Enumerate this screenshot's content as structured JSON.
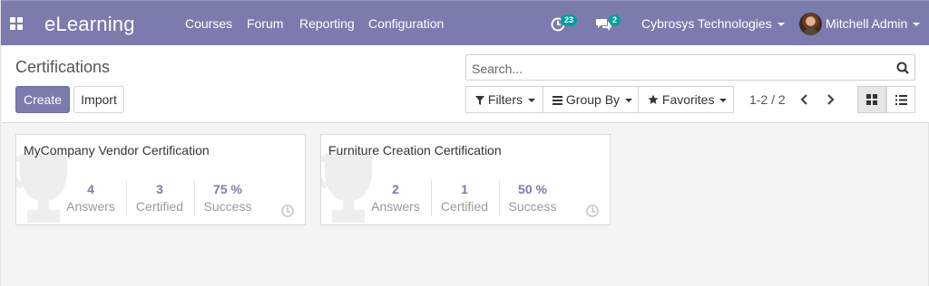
{
  "navbar": {
    "brand": "eLearning",
    "menu": [
      "Courses",
      "Forum",
      "Reporting",
      "Configuration"
    ],
    "activity_count": "23",
    "messages_count": "2",
    "company": "Cybrosys Technologies",
    "user": "Mitchell Admin",
    "accent_color": "#7c7bad",
    "badge_color": "#00a09d"
  },
  "control_panel": {
    "title": "Certifications",
    "create_label": "Create",
    "import_label": "Import",
    "search_placeholder": "Search...",
    "filters_label": "Filters",
    "groupby_label": "Group By",
    "favorites_label": "Favorites",
    "pager": "1-2 / 2"
  },
  "cards": [
    {
      "title": "MyCompany Vendor Certification",
      "answers": "4",
      "answers_label": "Answers",
      "certified": "3",
      "certified_label": "Certified",
      "success": "75 %",
      "success_label": "Success"
    },
    {
      "title": "Furniture Creation Certification",
      "answers": "2",
      "answers_label": "Answers",
      "certified": "1",
      "certified_label": "Certified",
      "success": "50 %",
      "success_label": "Success"
    }
  ]
}
